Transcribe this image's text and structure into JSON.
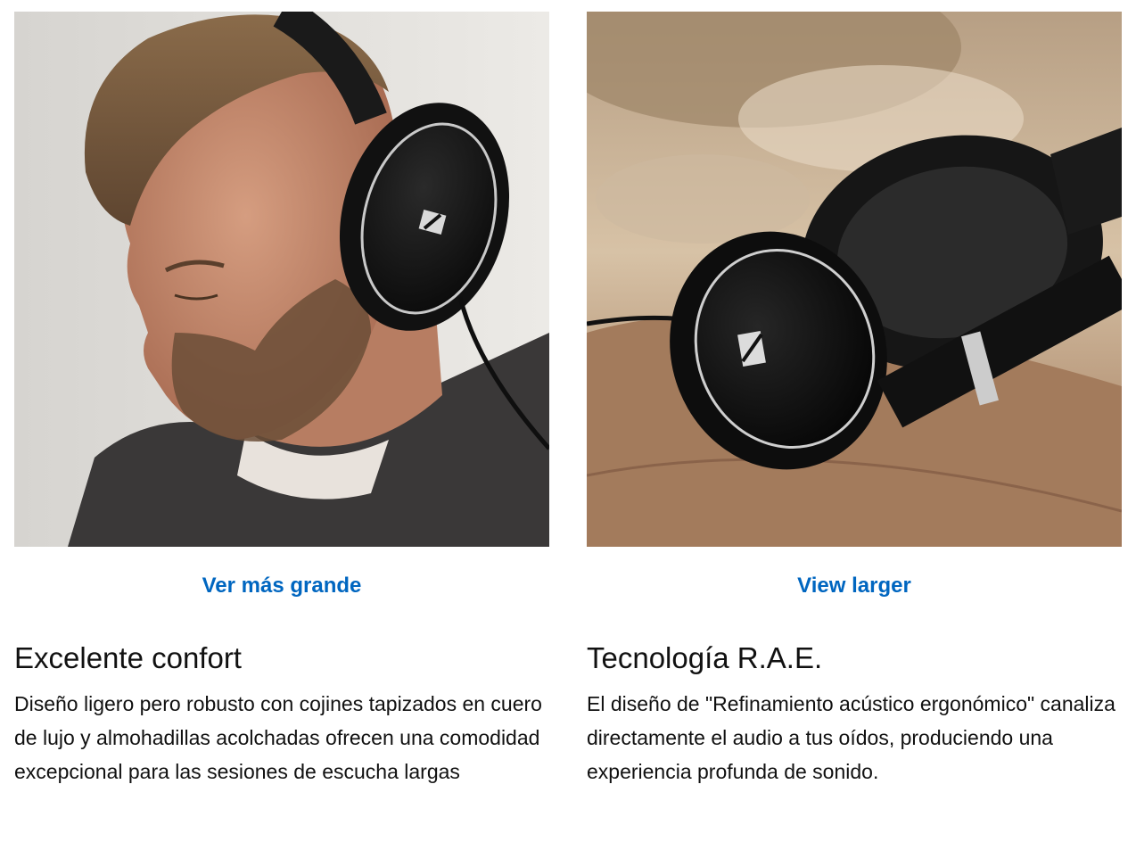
{
  "features": [
    {
      "image": {
        "subject": "man-wearing-headphones",
        "colors": {
          "background": "#dedcd8",
          "skin": "#c48b6f",
          "hair": "#7a5b3c",
          "shirt": "#3a3838",
          "headphone": "#151515",
          "trim": "#c9c9c9"
        }
      },
      "link_label": "Ver más grande",
      "title": "Excelente confort",
      "description": "Diseño ligero pero robusto con cojines tapizados en cuero de lujo y almohadillas acolchadas ofrecen una comodidad excepcional para las sesiones de escucha largas"
    },
    {
      "image": {
        "subject": "headphones-on-leather-surface",
        "colors": {
          "background": "#c7b39a",
          "leather": "#a37b5c",
          "headphone": "#141414",
          "trim": "#d0d0d0"
        }
      },
      "link_label": "View larger",
      "title": "Tecnología R.A.E.",
      "description": "El diseño de \"Refinamiento acústico ergonómico\" canaliza directamente el audio a tus oídos, produciendo una experiencia profunda de sonido."
    }
  ],
  "link_color": "#0066c0"
}
